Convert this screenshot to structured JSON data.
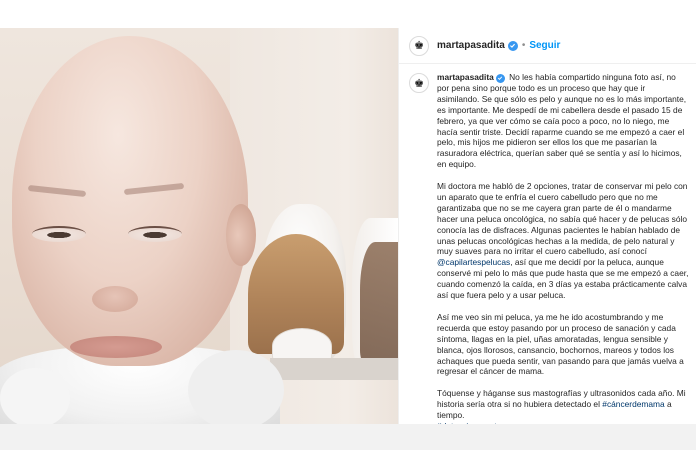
{
  "post": {
    "username": "martapasadita",
    "follow_label": "Seguir",
    "separator": "•",
    "avatar_glyph": "♚"
  },
  "caption": {
    "username": "martapasadita",
    "paragraphs": [
      "No les había compartido ninguna foto así, no por pena sino porque todo es un proceso que hay que ir asimilando. Se que sólo es pelo y aunque no es lo más importante, es importante. Me despedí de mi cabellera desde el pasado 15 de febrero, ya que ver cómo se caía poco a poco, no lo niego, me hacía sentir triste. Decidí raparme cuando se me empezó a caer el pelo, mis hijos me pidieron ser ellos los que me pasarían la rasuradora eléctrica, querían saber qué se sentía y así lo hicimos, en equipo.",
      "Mi doctora me habló de 2 opciones, tratar de conservar mi pelo con un aparato que te enfría el cuero cabelludo pero que no me garantizaba que no se me cayera gran parte de él o mandarme hacer una peluca oncológica, no sabía qué hacer y de pelucas sólo conocía las de disfraces. Algunas pacientes le habían hablado de unas pelucas oncológicas hechas a la medida, de pelo natural y muy suaves para no irritar el cuero cabelludo, así conocí",
      "así que me decidí por la peluca, aunque conservé mi pelo lo más que pude hasta que se me empezó a caer, cuando comenzó la caída, en 3 días ya estaba prácticamente calva así que fuera pelo y a usar peluca.",
      "Así me veo sin mi peluca, ya me he ido acostumbrando y me recuerda que estoy pasando por un proceso de sanación y cada síntoma, llagas en la piel, uñas amoratadas, lengua sensible y blanca, ojos llorosos, cansancio, bochornos, mareos y todos los achaques que pueda sentir, van pasando para que jamás vuelva a regresar el cáncer de mama.",
      "Tóquense y háganse sus mastografías y ultrasonidos cada año. Mi historia sería otra si no hubiera detectado el",
      "a tiempo."
    ],
    "mention": "@capilartespelucas",
    "hashtag_1": "#cáncerdemama",
    "hashtag_2": "#deteccionoportuna"
  },
  "colors": {
    "verified_badge": "#3897f0",
    "follow": "#0095f6",
    "link": "#00376b"
  },
  "icons": {
    "avatar": "crown-icon",
    "verified": "verified-badge-icon"
  }
}
